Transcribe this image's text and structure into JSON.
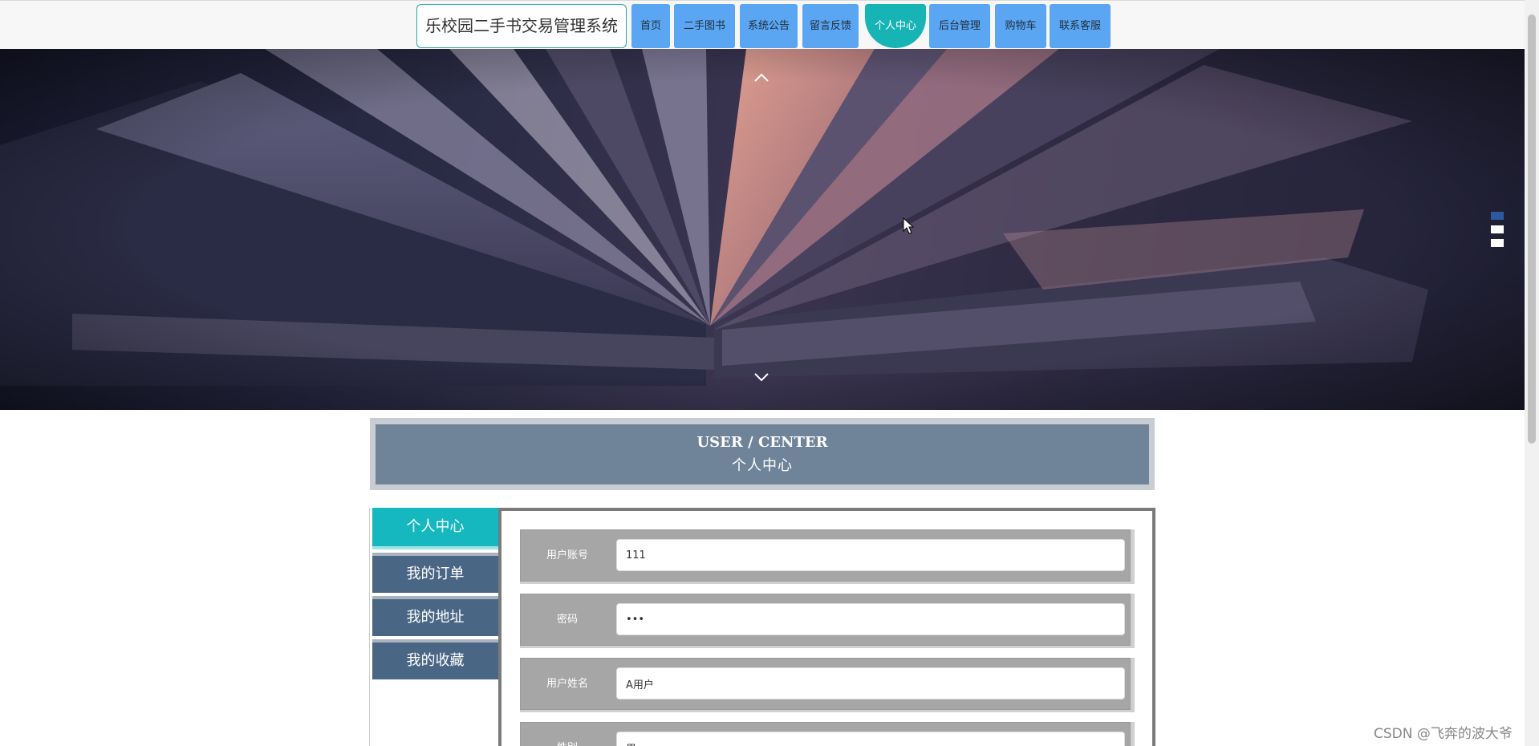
{
  "header": {
    "site_title": "乐校园二手书交易管理系统",
    "nav": [
      {
        "label": "首页",
        "active": false
      },
      {
        "label": "二手图书",
        "active": false
      },
      {
        "label": "系统公告",
        "active": false
      },
      {
        "label": "留言反馈",
        "active": false
      },
      {
        "label": "个人中心",
        "active": true
      },
      {
        "label": "后台管理",
        "active": false
      },
      {
        "label": "购物车",
        "active": false
      },
      {
        "label": "联系客服",
        "active": false
      }
    ]
  },
  "banner": {
    "prev_icon": "chevron-up-icon",
    "next_icon": "chevron-down-icon",
    "slides_count": 3,
    "active_slide": 1,
    "colors": {
      "dark": "#1b1c33",
      "page_light": "#c98a84",
      "dot_active": "#2c5aa0"
    }
  },
  "user_center": {
    "title_en": "USER / CENTER",
    "title_cn": "个人中心"
  },
  "side_menu": [
    {
      "label": "个人中心",
      "active": true
    },
    {
      "label": "我的订单",
      "active": false
    },
    {
      "label": "我的地址",
      "active": false
    },
    {
      "label": "我的收藏",
      "active": false
    }
  ],
  "form": {
    "fields": [
      {
        "label": "用户账号",
        "value": "111",
        "type": "text"
      },
      {
        "label": "密码",
        "value": "111",
        "type": "password"
      },
      {
        "label": "用户姓名",
        "value": "A用户",
        "type": "text"
      },
      {
        "label": "性别",
        "value": "男",
        "type": "text"
      }
    ]
  },
  "colors": {
    "nav_button": "#5ba6f2",
    "nav_active": "#16b4b4",
    "header_panel": "#708499",
    "menu_item": "#4a6685",
    "menu_active": "#16b8c0",
    "form_row": "#a6a6a6"
  },
  "watermark": "CSDN @飞奔的波大爷"
}
